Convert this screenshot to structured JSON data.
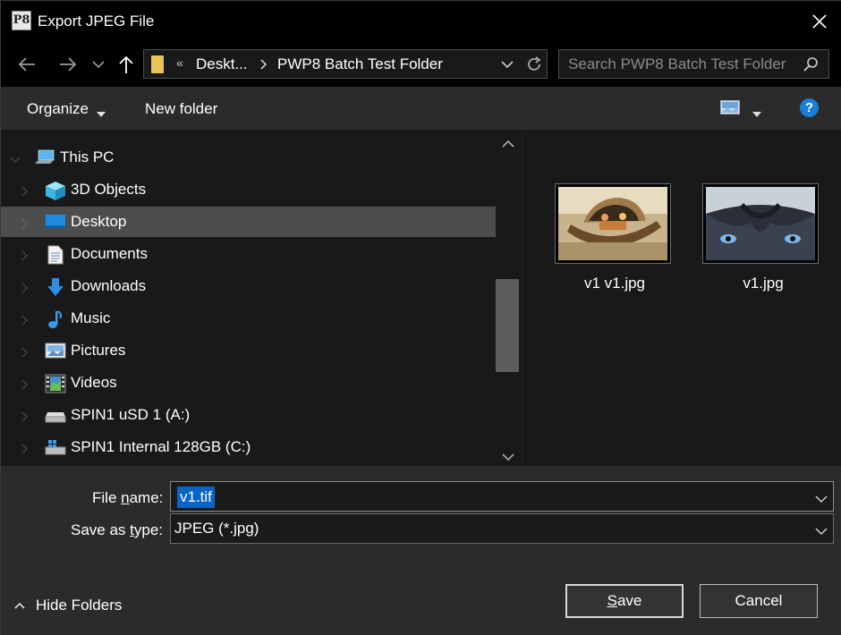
{
  "window": {
    "title": "Export JPEG File",
    "app_icon_text": "P8"
  },
  "nav": {
    "breadcrumb_overflow": "«",
    "breadcrumb": [
      "Deskt...",
      "PWP8 Batch Test Folder"
    ],
    "search_placeholder": "Search PWP8 Batch Test Folder"
  },
  "toolbar": {
    "organize_label": "Organize",
    "new_folder_label": "New folder",
    "help_label": "?"
  },
  "tree": {
    "items": [
      {
        "label": "This PC",
        "icon": "computer-icon",
        "selected": false
      },
      {
        "label": "3D Objects",
        "icon": "cube-icon",
        "selected": false
      },
      {
        "label": "Desktop",
        "icon": "desktop-icon",
        "selected": true
      },
      {
        "label": "Documents",
        "icon": "document-icon",
        "selected": false
      },
      {
        "label": "Downloads",
        "icon": "download-arrow-icon",
        "selected": false
      },
      {
        "label": "Music",
        "icon": "music-note-icon",
        "selected": false
      },
      {
        "label": "Pictures",
        "icon": "picture-icon",
        "selected": false
      },
      {
        "label": "Videos",
        "icon": "film-icon",
        "selected": false
      },
      {
        "label": "SPIN1 uSD 1 (A:)",
        "icon": "drive-icon",
        "selected": false
      },
      {
        "label": "SPIN1 Internal 128GB (C:)",
        "icon": "windows-drive-icon",
        "selected": false
      }
    ]
  },
  "files": [
    {
      "name": "v1 v1.jpg",
      "thumbnail": "boat-photo"
    },
    {
      "name": "v1.jpg",
      "thumbnail": "dog-eyes-photo"
    }
  ],
  "form": {
    "file_name_label_pre": "File ",
    "file_name_label_u": "n",
    "file_name_label_post": "ame:",
    "file_name_value": "v1.tif",
    "save_type_label_pre": "Save as ",
    "save_type_label_u": "t",
    "save_type_label_post": "ype:",
    "save_type_value": "JPEG (*.jpg)"
  },
  "footer": {
    "hide_folders_label": "Hide Folders",
    "save_label_u": "S",
    "save_label_rest": "ave",
    "cancel_label": "Cancel"
  },
  "colors": {
    "accent": "#1a7fd6",
    "selection": "#0a64c8"
  }
}
